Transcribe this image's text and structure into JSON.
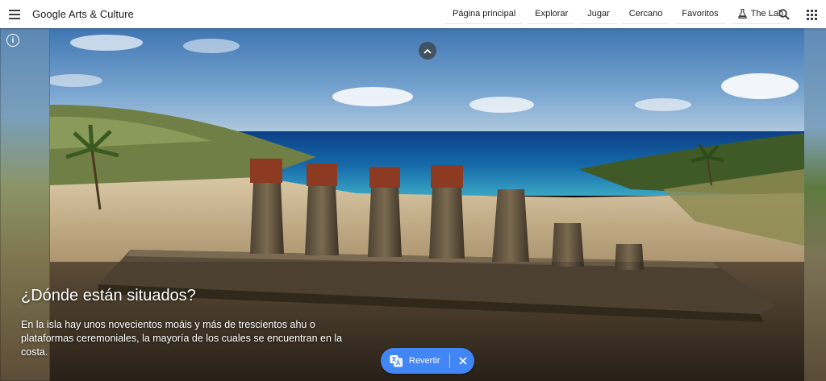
{
  "header": {
    "brand_google": "Google",
    "brand_rest": " Arts & Culture",
    "nav": [
      {
        "label": "Página principal"
      },
      {
        "label": "Explorar"
      },
      {
        "label": "Jugar"
      },
      {
        "label": "Cercano"
      },
      {
        "label": "Favoritos"
      },
      {
        "label": "The Lab",
        "icon": "flask-icon"
      }
    ],
    "icons": {
      "menu": "menu-icon",
      "search": "search-icon",
      "apps": "apps-grid-icon"
    }
  },
  "hero": {
    "info_symbol": "i",
    "title": "¿Dónde están situados?",
    "description": "En la isla hay unos novecientos moáis y más de trescientos ahu o plataformas ceremoniales, la mayoría de los cuales se encuentran en la costa."
  },
  "translate": {
    "label": "Revertir",
    "color": "#4285f4"
  }
}
